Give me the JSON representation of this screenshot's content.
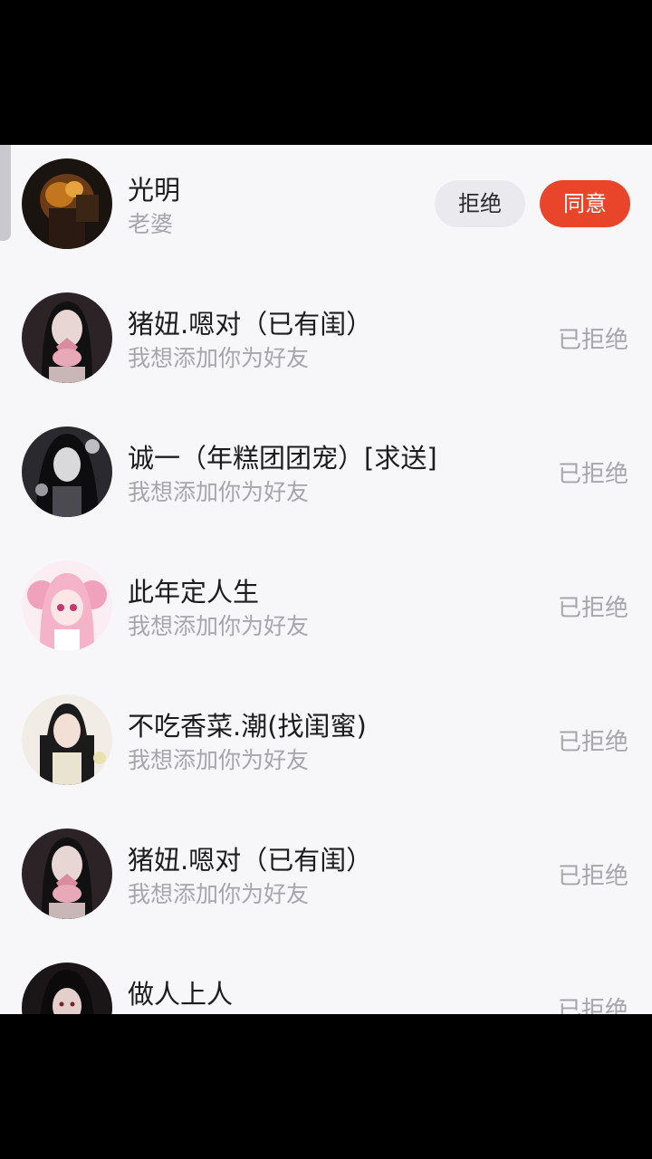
{
  "requests": [
    {
      "name": "光明",
      "message": "老婆",
      "reject_label": "拒绝",
      "accept_label": "同意",
      "avatar_icon": "avatar-dark-fire"
    },
    {
      "name": "猪妞.嗯对（已有闺）",
      "message": "我想添加你为好友",
      "status": "已拒绝",
      "avatar_icon": "avatar-girl-flower"
    },
    {
      "name": "诚一（年糕团团宠）[求送]",
      "message": "我想添加你为好友",
      "status": "已拒绝",
      "avatar_icon": "avatar-gothic-girl"
    },
    {
      "name": "此年定人生",
      "message": "我想添加你为好友",
      "status": "已拒绝",
      "avatar_icon": "avatar-pink-anime"
    },
    {
      "name": "不吃香菜.潮(找闺蜜)",
      "message": "我想添加你为好友",
      "status": "已拒绝",
      "avatar_icon": "avatar-girl-braids"
    },
    {
      "name": "猪妞.嗯对（已有闺）",
      "message": "我想添加你为好友",
      "status": "已拒绝",
      "avatar_icon": "avatar-girl-flower"
    },
    {
      "name": "做人上人",
      "message": "",
      "status": "已拒绝",
      "avatar_icon": "avatar-dark-hair"
    }
  ],
  "colors": {
    "accent": "#e8452b",
    "background": "#f7f7fa",
    "muted": "#a6a6ab"
  }
}
